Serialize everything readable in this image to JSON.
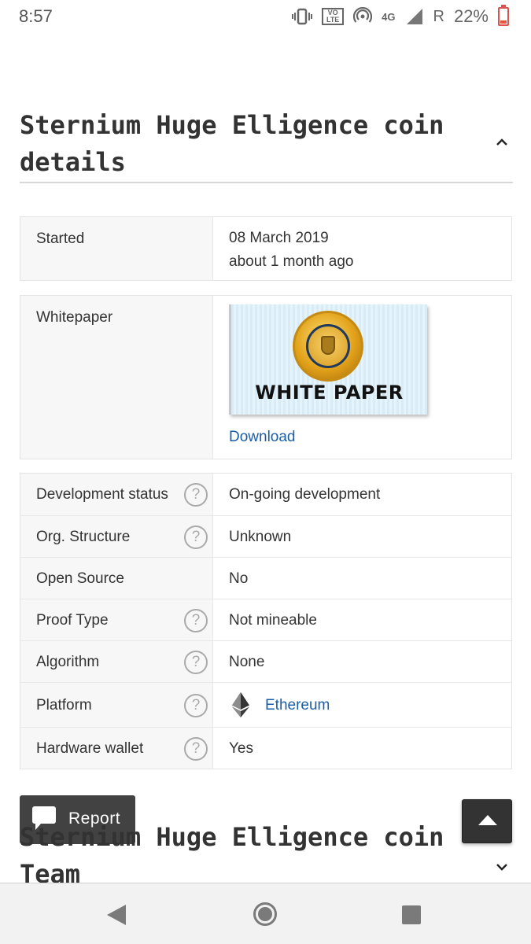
{
  "status_bar": {
    "time": "8:57",
    "icons": [
      "vibrate-icon",
      "volte-icon",
      "hotspot-icon",
      "network-4g-icon",
      "signal-icon",
      "roaming-icon",
      "battery-icon"
    ],
    "volte_line1": "VO",
    "volte_line2": "LTE",
    "network": "4G",
    "roaming": "R",
    "battery_percent": "22%",
    "battery_level": 0.22,
    "battery_color": "#e2573b"
  },
  "details_section": {
    "title": "Sternium Huge Elligence coin details",
    "expanded": true
  },
  "started": {
    "label": "Started",
    "date": "08 March 2019",
    "relative": "about 1 month ago"
  },
  "whitepaper": {
    "label": "Whitepaper",
    "image_text": "WHITE PAPER",
    "download_label": "Download"
  },
  "attributes": {
    "rows": [
      {
        "label": "Development status",
        "value": "On-going development",
        "help": true
      },
      {
        "label": "Org. Structure",
        "value": "Unknown",
        "help": true
      },
      {
        "label": "Open Source",
        "value": "No",
        "help": false
      },
      {
        "label": "Proof Type",
        "value": "Not mineable",
        "help": true
      },
      {
        "label": "Algorithm",
        "value": "None",
        "help": true
      },
      {
        "label": "Platform",
        "value": "Ethereum",
        "help": true,
        "icon": "ethereum-icon",
        "link": true
      },
      {
        "label": "Hardware wallet",
        "value": "Yes",
        "help": true
      }
    ],
    "help_glyph": "?"
  },
  "team_section": {
    "title": "Sternium Huge Elligence coin Team",
    "expanded": false
  },
  "floating": {
    "report_label": "Report",
    "report_icon": "chat-bubble-icon",
    "scroll_top_icon": "arrow-up-icon"
  },
  "navigation": {
    "icons": [
      "back-icon",
      "home-icon",
      "recents-icon"
    ]
  },
  "colors": {
    "link": "#1a5ea8",
    "label_bg": "#f7f7f7",
    "text": "#333333"
  }
}
